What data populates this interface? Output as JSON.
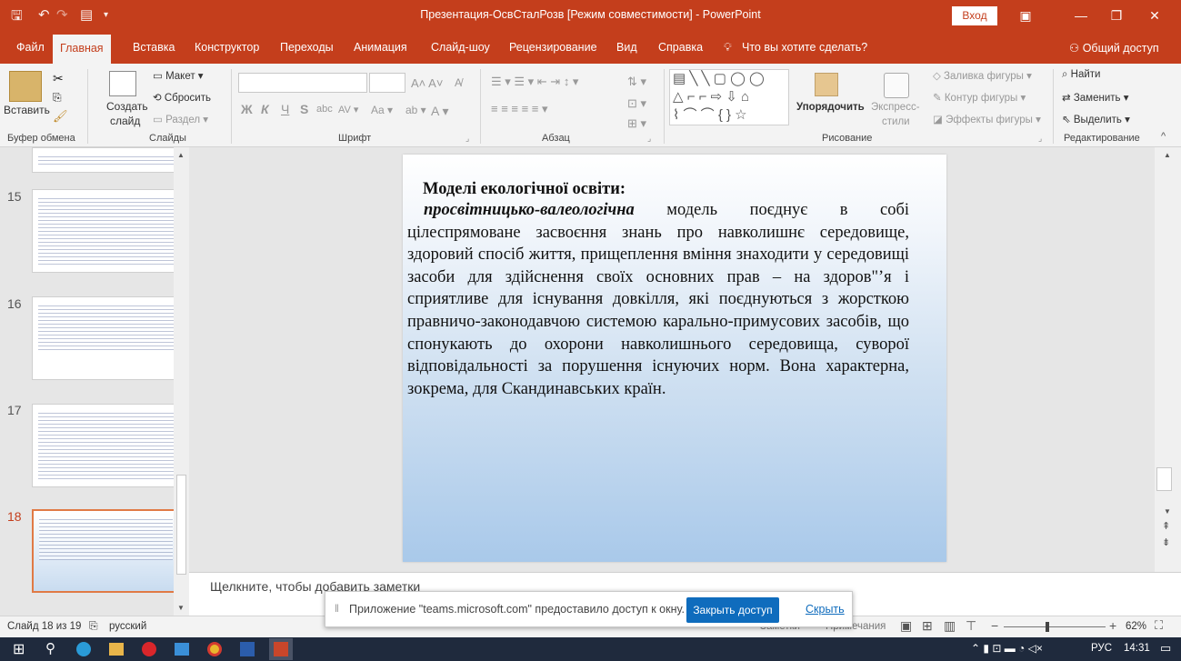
{
  "window": {
    "title": "Презентация-ОсвСталРозв [Режим совместимости] - PowerPoint",
    "signin_label": "Вход",
    "share_label": "Общий доступ"
  },
  "tabs": [
    "Файл",
    "Главная",
    "Вставка",
    "Конструктор",
    "Переходы",
    "Анимация",
    "Слайд-шоу",
    "Рецензирование",
    "Вид",
    "Справка"
  ],
  "tell_me": "Что вы хотите сделать?",
  "ribbon": {
    "clipboard": {
      "paste": "Вставить",
      "group": "Буфер обмена"
    },
    "slides": {
      "new_slide_1": "Создать",
      "new_slide_2": "слайд",
      "layout": "Макет",
      "reset": "Сбросить",
      "section": "Раздел",
      "group": "Слайды"
    },
    "font": {
      "bold": "Ж",
      "italic": "К",
      "underline": "Ч",
      "strike": "S",
      "group": "Шрифт"
    },
    "paragraph": {
      "group": "Абзац"
    },
    "drawing": {
      "arrange": "Упорядочить",
      "quick_styles_1": "Экспресс-",
      "quick_styles_2": "стили",
      "fill": "Заливка фигуры",
      "outline": "Контур фигуры",
      "effects": "Эффекты фигуры",
      "group": "Рисование"
    },
    "editing": {
      "find": "Найти",
      "replace": "Заменить",
      "select": "Выделить",
      "group": "Редактирование"
    }
  },
  "thumbnails": [
    {
      "num": "15"
    },
    {
      "num": "16"
    },
    {
      "num": "17"
    },
    {
      "num": "18"
    }
  ],
  "slide": {
    "title": "Моделі екологічної освіти:",
    "lead": "просвітницько-валеологічна",
    "text": " модель поєднує в собі цілеспрямоване засвоєння знань про навколишнє середовище, здоровий спосіб життя, прищеплення вміння знаходити у середовищі засоби для здійснення своїх основних прав – на здоров\"’я і сприятливе для існування довкілля, які поєднуються з жорсткою правничо-законодавчою системою карально-примусових засобів, що спонукають до охорони навколишнього середовища, суворої відповідальності за порушення існуючих норм. Вона характерна, зокрема, для Скандинавських країн."
  },
  "notes_placeholder": "Щелкните, чтобы добавить заметки",
  "statusbar": {
    "slide_counter": "Слайд 18 из 19",
    "language": "русский",
    "notes": "Заметки",
    "comments": "Примечания",
    "zoom": "62%"
  },
  "share_notice": {
    "text": "Приложение \"teams.microsoft.com\" предоставило доступ к окну.",
    "stop": "Закрыть доступ",
    "hide": "Скрыть"
  },
  "taskbar": {
    "lang": "РУС",
    "time": "14:31"
  },
  "colors": {
    "accent": "#c43e1c",
    "share_button": "#0f6cbd"
  }
}
